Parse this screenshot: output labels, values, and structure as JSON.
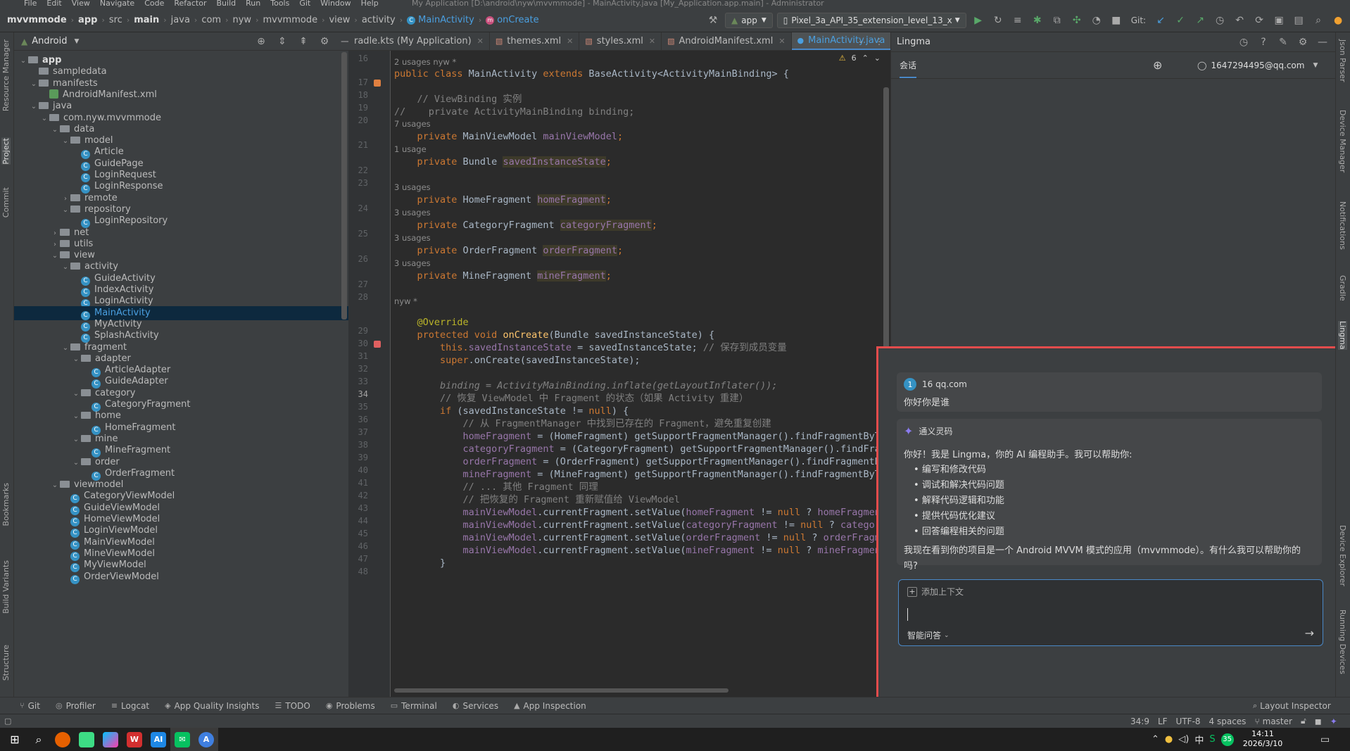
{
  "window": {
    "menu": [
      "File",
      "Edit",
      "View",
      "Navigate",
      "Code",
      "Refactor",
      "Build",
      "Run",
      "Tools",
      "Git",
      "Window",
      "Help"
    ],
    "title": "My Application [D:\\android\\nyw\\mvvmmode] - MainActivity.java [My_Application.app.main] - Administrator"
  },
  "breadcrumb": [
    "mvvmmode",
    "app",
    "src",
    "main",
    "java",
    "com",
    "nyw",
    "mvvmmode",
    "view",
    "activity",
    "MainActivity",
    "onCreate"
  ],
  "toolbar": {
    "run_config": "app",
    "device": "Pixel_3a_API_35_extension_level_13_x",
    "git_label": "Git:"
  },
  "project": {
    "view_mode": "Android",
    "tree": [
      {
        "label": "app",
        "icon": "folder",
        "arrow": "v",
        "level": 0,
        "bold": true
      },
      {
        "label": "sampledata",
        "icon": "folder",
        "arrow": "",
        "level": 1
      },
      {
        "label": "manifests",
        "icon": "folder",
        "arrow": "v",
        "level": 1
      },
      {
        "label": "AndroidManifest.xml",
        "icon": "xml",
        "arrow": "",
        "level": 2
      },
      {
        "label": "java",
        "icon": "folder",
        "arrow": "v",
        "level": 1
      },
      {
        "label": "com.nyw.mvvmmode",
        "icon": "folder",
        "arrow": "v",
        "level": 2
      },
      {
        "label": "data",
        "icon": "folder",
        "arrow": "v",
        "level": 3
      },
      {
        "label": "model",
        "icon": "folder",
        "arrow": "v",
        "level": 4
      },
      {
        "label": "Article",
        "icon": "class",
        "arrow": "",
        "level": 5
      },
      {
        "label": "GuidePage",
        "icon": "class",
        "arrow": "",
        "level": 5
      },
      {
        "label": "LoginRequest",
        "icon": "class",
        "arrow": "",
        "level": 5
      },
      {
        "label": "LoginResponse",
        "icon": "class",
        "arrow": "",
        "level": 5
      },
      {
        "label": "remote",
        "icon": "folder",
        "arrow": ">",
        "level": 4
      },
      {
        "label": "repository",
        "icon": "folder",
        "arrow": "v",
        "level": 4
      },
      {
        "label": "LoginRepository",
        "icon": "class",
        "arrow": "",
        "level": 5
      },
      {
        "label": "net",
        "icon": "folder",
        "arrow": ">",
        "level": 3
      },
      {
        "label": "utils",
        "icon": "folder",
        "arrow": ">",
        "level": 3
      },
      {
        "label": "view",
        "icon": "folder",
        "arrow": "v",
        "level": 3
      },
      {
        "label": "activity",
        "icon": "folder",
        "arrow": "v",
        "level": 4
      },
      {
        "label": "GuideActivity",
        "icon": "class",
        "arrow": "",
        "level": 5
      },
      {
        "label": "IndexActivity",
        "icon": "class",
        "arrow": "",
        "level": 5
      },
      {
        "label": "LoginActivity",
        "icon": "class",
        "arrow": "",
        "level": 5
      },
      {
        "label": "MainActivity",
        "icon": "class",
        "arrow": "",
        "level": 5,
        "selected": true
      },
      {
        "label": "MyActivity",
        "icon": "class",
        "arrow": "",
        "level": 5
      },
      {
        "label": "SplashActivity",
        "icon": "class",
        "arrow": "",
        "level": 5
      },
      {
        "label": "fragment",
        "icon": "folder",
        "arrow": "v",
        "level": 4
      },
      {
        "label": "adapter",
        "icon": "folder",
        "arrow": "v",
        "level": 5
      },
      {
        "label": "ArticleAdapter",
        "icon": "class",
        "arrow": "",
        "level": 6
      },
      {
        "label": "GuideAdapter",
        "icon": "class",
        "arrow": "",
        "level": 6
      },
      {
        "label": "category",
        "icon": "folder",
        "arrow": "v",
        "level": 5
      },
      {
        "label": "CategoryFragment",
        "icon": "class",
        "arrow": "",
        "level": 6
      },
      {
        "label": "home",
        "icon": "folder",
        "arrow": "v",
        "level": 5
      },
      {
        "label": "HomeFragment",
        "icon": "class",
        "arrow": "",
        "level": 6
      },
      {
        "label": "mine",
        "icon": "folder",
        "arrow": "v",
        "level": 5
      },
      {
        "label": "MineFragment",
        "icon": "class",
        "arrow": "",
        "level": 6
      },
      {
        "label": "order",
        "icon": "folder",
        "arrow": "v",
        "level": 5
      },
      {
        "label": "OrderFragment",
        "icon": "class",
        "arrow": "",
        "level": 6
      },
      {
        "label": "viewmodel",
        "icon": "folder",
        "arrow": "v",
        "level": 3
      },
      {
        "label": "CategoryViewModel",
        "icon": "class",
        "arrow": "",
        "level": 4
      },
      {
        "label": "GuideViewModel",
        "icon": "class",
        "arrow": "",
        "level": 4
      },
      {
        "label": "HomeViewModel",
        "icon": "class",
        "arrow": "",
        "level": 4
      },
      {
        "label": "LoginViewModel",
        "icon": "class",
        "arrow": "",
        "level": 4
      },
      {
        "label": "MainViewModel",
        "icon": "class",
        "arrow": "",
        "level": 4
      },
      {
        "label": "MineViewModel",
        "icon": "class",
        "arrow": "",
        "level": 4
      },
      {
        "label": "MyViewModel",
        "icon": "class",
        "arrow": "",
        "level": 4
      },
      {
        "label": "OrderViewModel",
        "icon": "class",
        "arrow": "",
        "level": 4
      }
    ]
  },
  "left_tool_windows": [
    "Resource Manager",
    "Project",
    "Commit",
    "Bookmarks",
    "Build Variants",
    "Structure"
  ],
  "right_tool_windows": [
    "Json Parser",
    "Device Manager",
    "Notifications",
    "Gradle",
    "Lingma",
    "Device Explorer",
    "Running Devices"
  ],
  "editor": {
    "tabs": [
      {
        "label": "radle.kts (My Application)",
        "active": false
      },
      {
        "label": "themes.xml",
        "active": false
      },
      {
        "label": "styles.xml",
        "active": false
      },
      {
        "label": "AndroidManifest.xml",
        "active": false
      },
      {
        "label": "MainActivity.java",
        "active": true
      }
    ],
    "warnings": "6",
    "hints": {
      "h17": "2 usages   nyw *",
      "h21": "7 usages",
      "h22": "1 usage",
      "h24": "3 usages",
      "h25": "3 usages",
      "h26": "3 usages",
      "h27": "3 usages",
      "h29": "nyw *"
    },
    "line_numbers": [
      "16",
      "17",
      "18",
      "19",
      "20",
      "21",
      "22",
      "23",
      "24",
      "25",
      "26",
      "27",
      "28",
      "29",
      "30",
      "31",
      "32",
      "33",
      "34",
      "35",
      "36",
      "37",
      "38",
      "39",
      "40",
      "41",
      "42",
      "43",
      "44",
      "45",
      "46",
      "47",
      "48"
    ],
    "code": {
      "l17a": "public class ",
      "l17b": "MainActivity ",
      "l17c": "extends ",
      "l17d": "BaseActivity<ActivityMainBinding> {",
      "l19": "    // ViewBinding 实例",
      "l20": "//    private ActivityMainBinding binding;",
      "l21a": "    private ",
      "l21b": "MainViewModel ",
      "l21c": "mainViewModel",
      "l21d": ";",
      "l22a": "    private ",
      "l22b": "Bundle ",
      "l22c": "savedInstanceState",
      "l22d": ";",
      "l24a": "    private ",
      "l24b": "HomeFragment ",
      "l24c": "homeFragment",
      "l24d": ";",
      "l25a": "    private ",
      "l25b": "CategoryFragment ",
      "l25c": "categoryFragment",
      "l25d": ";",
      "l26a": "    private ",
      "l26b": "OrderFragment ",
      "l26c": "orderFragment",
      "l26d": ";",
      "l27a": "    private ",
      "l27b": "MineFragment ",
      "l27c": "mineFragment",
      "l27d": ";",
      "l29": "    @Override",
      "l30a": "    protected void ",
      "l30b": "onCreate",
      "l30c": "(Bundle savedInstanceState) {",
      "l31a": "        this.",
      "l31b": "savedInstanceState",
      "l31c": " = savedInstanceState; ",
      "l31d": "// 保存到成员变量",
      "l32a": "        super",
      "l32b": ".onCreate(savedInstanceState);",
      "l34": "        binding = ActivityMainBinding.inflate(getLayoutInflater());",
      "l35": "        // 恢复 ViewModel 中 Fragment 的状态（如果 Activity 重建）",
      "l36a": "        if ",
      "l36b": "(savedInstanceState != ",
      "l36c": "null",
      "l36d": ") {",
      "l37": "            // 从 FragmentManager 中找到已存在的 Fragment，避免重复创建",
      "l38a": "            ",
      "l38b": "homeFragment",
      "l38c": " = (HomeFragment) getSupportFragmentManager().findFragmentByTag(",
      "l39a": "            ",
      "l39b": "categoryFragment",
      "l39c": " = (CategoryFragment) getSupportFragmentManager().findFragme",
      "l40a": "            ",
      "l40b": "orderFragment",
      "l40c": " = (OrderFragment) getSupportFragmentManager().findFragmentByTa",
      "l41a": "            ",
      "l41b": "mineFragment",
      "l41c": " = (MineFragment) getSupportFragmentManager().findFragmentByTag(",
      "l42": "            // ... 其他 Fragment 同理",
      "l43": "            // 把恢复的 Fragment 重新赋值给 ViewModel",
      "l44a": "            ",
      "l44b": "mainViewModel",
      "l44c": ".currentFragment.setValue(",
      "l44d": "homeFragment",
      "l44e": " != ",
      "l44f": "null",
      "l44g": " ? ",
      "l44h": "homeFragment :",
      "l45a": "            ",
      "l45b": "mainViewModel",
      "l45c": ".currentFragment.setValue(",
      "l45d": "categoryFragment",
      "l45e": " != ",
      "l45f": "null",
      "l45g": " ? ",
      "l45h": "categoryFr",
      "l46a": "            ",
      "l46b": "mainViewModel",
      "l46c": ".currentFragment.setValue(",
      "l46d": "orderFragment",
      "l46e": " != ",
      "l46f": "null",
      "l46g": " ? ",
      "l46h": "orderFragm",
      "l47a": "            ",
      "l47b": "mainViewModel",
      "l47c": ".currentFragment.setValue(",
      "l47d": "mineFragment",
      "l47e": " != ",
      "l47f": "null",
      "l47g": " ? ",
      "l47h": "mineFragment :",
      "l48": "        }"
    }
  },
  "lingma": {
    "title": "Lingma",
    "tab_label": "会话",
    "account": "1647294495@qq.com",
    "user": {
      "avatar_letter": "1",
      "email": "16           qq.com",
      "message": "你好你是谁"
    },
    "assistant": {
      "name": "通义灵码",
      "intro": "你好！我是 Lingma，你的 AI 编程助手。我可以帮助你:",
      "bullets": [
        "编写和修改代码",
        "调试和解决代码问题",
        "解释代码逻辑和功能",
        "提供代码优化建议",
        "回答编程相关的问题"
      ],
      "outro1": "我现在看到你的项目是一个 Android MVVM 模式的应用（mvvmmode）。有什么我可以帮助你的",
      "outro2": "吗?"
    },
    "input": {
      "add_context": "添加上下文",
      "mode": "智能问答"
    }
  },
  "bottom_tools": [
    "Git",
    "Profiler",
    "Logcat",
    "App Quality Insights",
    "TODO",
    "Problems",
    "Terminal",
    "Services",
    "App Inspection"
  ],
  "layout_inspector": "Layout Inspector",
  "status": {
    "position": "34:9",
    "line_sep": "LF",
    "encoding": "UTF-8",
    "indent": "4 spaces",
    "branch": "master"
  },
  "taskbar": {
    "time": "14:11",
    "date": "2026/3/10",
    "ime": "中",
    "badge": "35"
  }
}
